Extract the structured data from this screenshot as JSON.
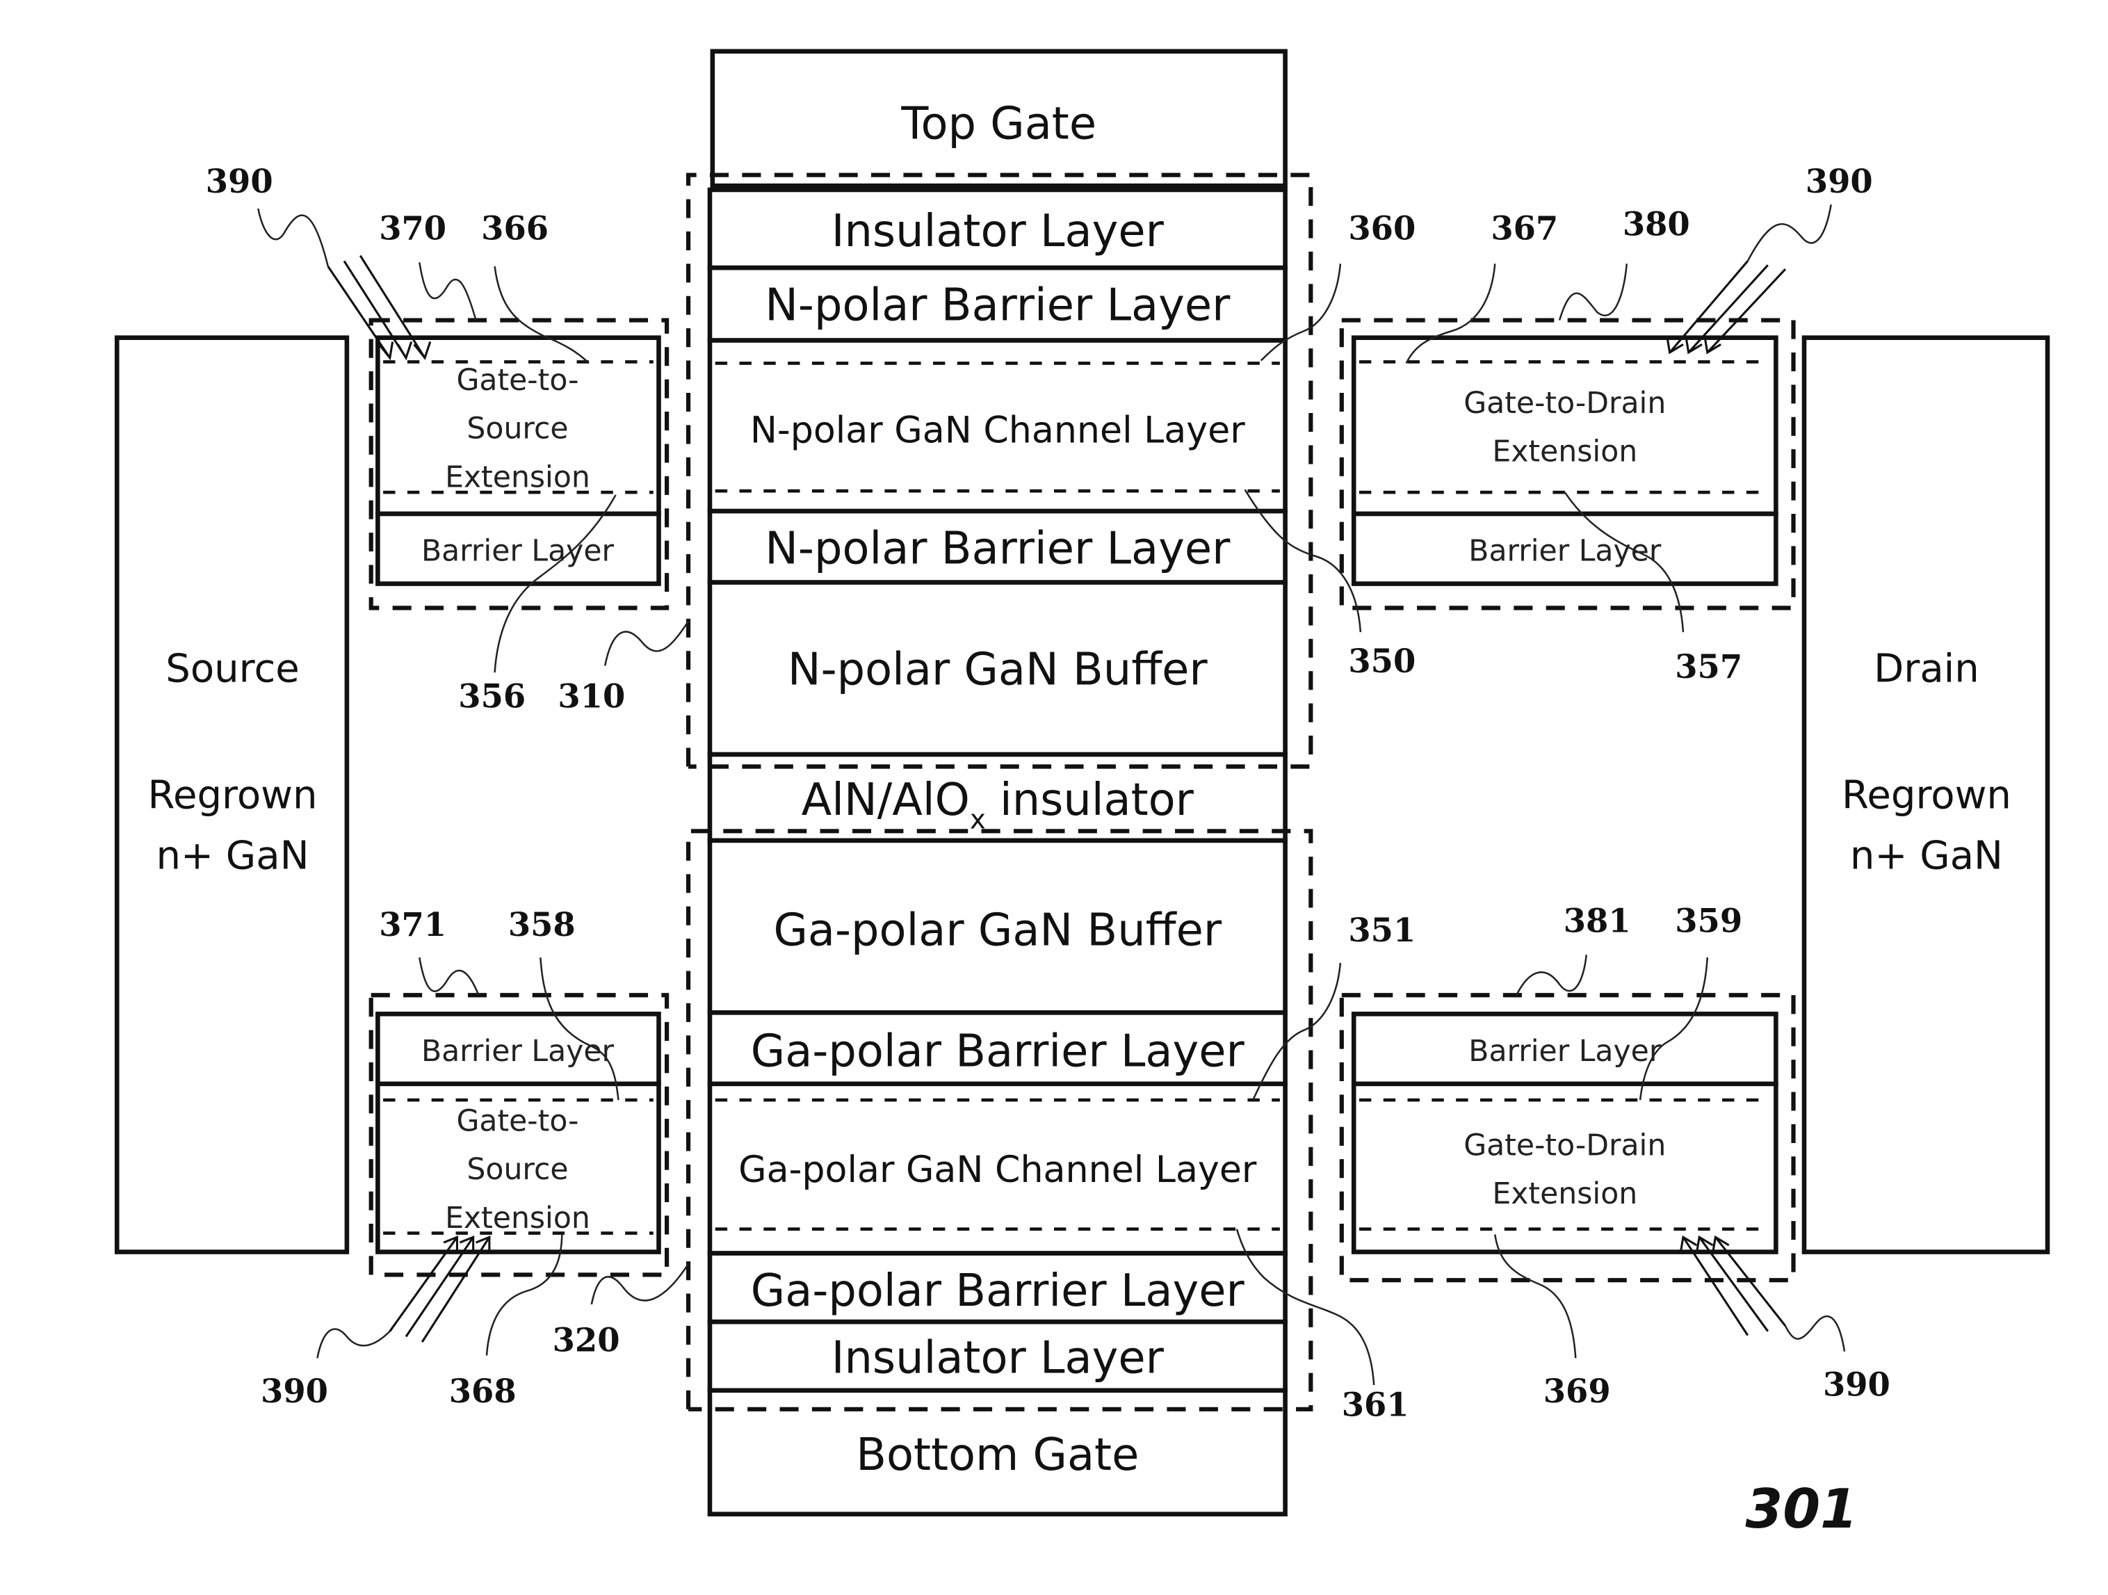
{
  "figure": {
    "figure_number": "301",
    "stack": {
      "top_gate": "Top Gate",
      "insulator_top": "Insulator Layer",
      "n_barrier_top": "N-polar Barrier Layer",
      "n_channel": "N-polar GaN Channel Layer",
      "n_barrier_bottom": "N-polar Barrier Layer",
      "n_buffer": "N-polar GaN Buffer",
      "aln_insulator": "AlN/AlO",
      "aln_insulator_subscript": "x",
      "aln_insulator_suffix": " insulator",
      "ga_buffer": "Ga-polar GaN Buffer",
      "ga_barrier_top": "Ga-polar Barrier Layer",
      "ga_channel": "Ga-polar GaN Channel Layer",
      "ga_barrier_bottom": "Ga-polar Barrier Layer",
      "insulator_bottom": "Insulator Layer",
      "bottom_gate": "Bottom Gate"
    },
    "source": {
      "line1": "Source",
      "line2": "Regrown",
      "line3": "n+ GaN"
    },
    "drain": {
      "line1": "Drain",
      "line2": "Regrown",
      "line3": "n+ GaN"
    },
    "extensions": {
      "gs_top": {
        "line1": "Gate-to-",
        "line2": "Source",
        "line3": "Extension",
        "barrier": "Barrier Layer"
      },
      "gs_bottom": {
        "line1": "Gate-to-",
        "line2": "Source",
        "line3": "Extension",
        "barrier": "Barrier Layer"
      },
      "gd_top": {
        "line1": "Gate-to-Drain",
        "line2": "Extension",
        "barrier": "Barrier Layer"
      },
      "gd_bottom": {
        "line1": "Gate-to-Drain",
        "line2": "Extension",
        "barrier": "Barrier Layer"
      }
    },
    "reference_numerals": {
      "r390_tl": "390",
      "r370": "370",
      "r366": "366",
      "r360": "360",
      "r367": "367",
      "r380": "380",
      "r390_tr": "390",
      "r356": "356",
      "r310": "310",
      "r350": "350",
      "r357": "357",
      "r371": "371",
      "r358": "358",
      "r351": "351",
      "r381": "381",
      "r359": "359",
      "r390_bl": "390",
      "r368": "368",
      "r320": "320",
      "r361": "361",
      "r369": "369",
      "r390_br": "390"
    }
  }
}
